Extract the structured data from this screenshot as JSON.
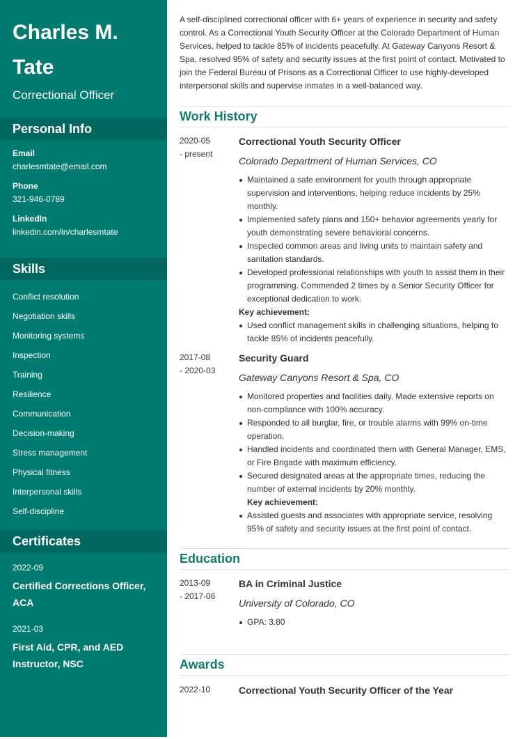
{
  "sidebar": {
    "name": "Charles M. Tate",
    "title": "Correctional Officer",
    "personal_info": {
      "heading": "Personal Info",
      "items": [
        {
          "label": "Email",
          "value": "charlesmtate@email.com"
        },
        {
          "label": "Phone",
          "value": "321-946-0789"
        },
        {
          "label": "LinkedIn",
          "value": "linkedin.com/in/charlesmtate"
        }
      ]
    },
    "skills": {
      "heading": "Skills",
      "items": [
        "Conflict resolution",
        "Negotiation skills",
        "Monitoring systems",
        "Inspection",
        "Training",
        "Resilience",
        "Communication",
        "Decision-making",
        "Stress management",
        "Physical fitness",
        "Interpersonal skills",
        "Self-discipline"
      ]
    },
    "certificates": {
      "heading": "Certificates",
      "items": [
        {
          "date": "2022-09",
          "name": "Certified Corrections Officer, ACA"
        },
        {
          "date": "2021-03",
          "name": "First Aid, CPR, and AED Instructor, NSC"
        }
      ]
    }
  },
  "main": {
    "summary": "A self-disciplined correctional officer with 6+ years of experience in security and safety control. As a Correctional Youth Security Officer at the Colorado Department of Human Services, helped to tackle 85% of incidents peacefully. At Gateway Canyons Resort & Spa, resolved 95% of safety and security issues at the first point of contact. Motivated to join the Federal Bureau of Prisons as a Correctional Officer to use highly-developed interpersonal skills and supervise inmates in a well-balanced way.",
    "work_history": {
      "heading": "Work History",
      "entries": [
        {
          "date_start": "2020-05",
          "date_end": "- present",
          "title": "Correctional Youth Security Officer",
          "org": "Colorado Department of Human Services, CO",
          "bullets": [
            "Maintained a safe environment for youth through appropriate supervision and interventions, helping reduce incidents by 25% monthly.",
            "Implemented safety plans and 150+ behavior agreements yearly for youth demonstrating severe behavioral concerns.",
            "Inspected common areas and living units to maintain safety and sanitation standards.",
            "Developed professional relationships with youth to assist them in their programming. Commended 2 times by a Senior Security Officer for exceptional dedication to work."
          ],
          "key_label": "Key achievement:",
          "key_bullets": [
            "Used conflict management skills in challenging situations, helping to tackle 85% of incidents peacefully."
          ]
        },
        {
          "date_start": "2017-08",
          "date_end": "- 2020-03",
          "title": "Security Guard",
          "org": "Gateway Canyons Resort & Spa, CO",
          "bullets": [
            "Monitored properties and facilities daily. Made extensive reports on non-compliance with 100% accuracy.",
            "Responded to all burglar, fire, or trouble alarms with 99% on-time operation.",
            "Handled incidents and coordinated them with General Manager, EMS, or Fire Brigade with maximum efficiency.",
            "Secured designated areas at the appropriate times, reducing the number of external incidents by 20% monthly."
          ],
          "key_label": "Key achievement:",
          "key_bullets": [
            "Assisted guests and associates with appropriate service, resolving 95% of safety and security issues at the first point of contact."
          ]
        }
      ]
    },
    "education": {
      "heading": "Education",
      "entries": [
        {
          "date_start": "2013-09",
          "date_end": "- 2017-06",
          "title": "BA in Criminal Justice",
          "org": "University of Colorado, CO",
          "bullets": [
            "GPA: 3.80"
          ]
        }
      ]
    },
    "awards": {
      "heading": "Awards",
      "entries": [
        {
          "date": "2022-10",
          "title": "Correctional Youth Security Officer of the Year"
        }
      ]
    }
  }
}
